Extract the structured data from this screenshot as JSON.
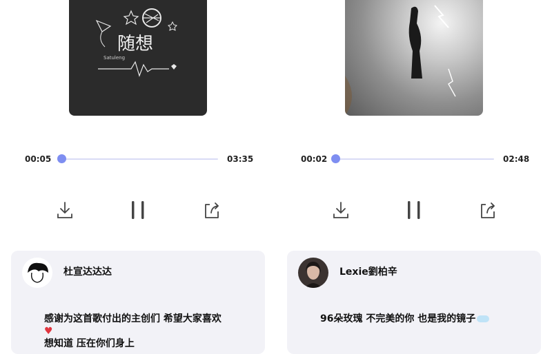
{
  "players": [
    {
      "cover_text": "随想",
      "cover_subtext": "Satuleng",
      "elapsed": "00:05",
      "duration": "03:35",
      "progress": 0.0,
      "controls": [
        "download-icon",
        "pause-icon",
        "share-icon"
      ],
      "comment": {
        "user": "杜宣达达达",
        "line1": "感谢为这首歌付出的主创们  希望大家喜欢",
        "line2": "♥",
        "line3": "想知道  压在你们身上"
      }
    },
    {
      "cover_text": "",
      "elapsed": "00:02",
      "duration": "02:48",
      "progress": 0.0,
      "controls": [
        "download-icon",
        "pause-icon",
        "share-icon"
      ],
      "comment": {
        "user": "Lexie劉柏辛",
        "line1": "96朵玫瑰 不完美的你 也是我的镜子"
      }
    }
  ],
  "colors": {
    "accent": "#7e8ef1",
    "track": "#d9dbf5",
    "card_bg": "#f2f2f7"
  }
}
